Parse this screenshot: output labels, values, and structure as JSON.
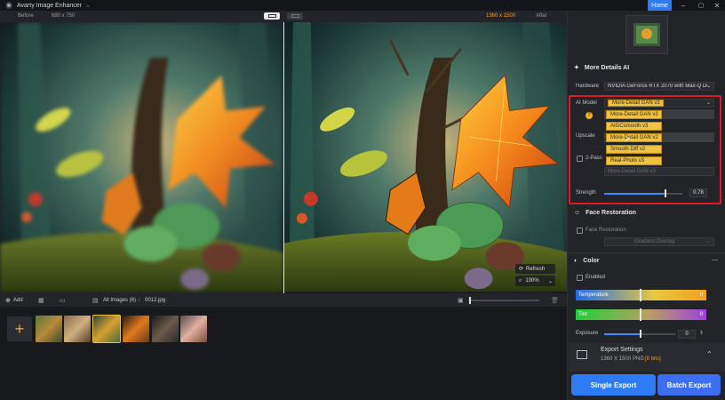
{
  "app": {
    "title": "Avarty Image Enhancer",
    "home": "Home"
  },
  "compare": {
    "before": "Before",
    "before_size": "680 x 750",
    "after_size": "1360 x 1500",
    "after": "After"
  },
  "viewer": {
    "refresh": "Refresh",
    "zoom": "100%"
  },
  "image_bar": {
    "add": "Add",
    "breadcrumb": "All Images (6)",
    "separator": "/",
    "file": "0012.jpg"
  },
  "panel": {
    "section_title": "More Details AI",
    "hardware_label": "Hardware",
    "hardware_value": "NVIDIA GeForce RTX 2070 with Max-Q Desig",
    "ai_model_label": "AI Model",
    "ai_model_value": "More-Detail GAN  v3",
    "upscale_label": "Upscale",
    "two_pass_label": "2-Pass",
    "ghost_select": "More-Detail GAN  v3",
    "options": [
      "More-Detail GAN  v3",
      "AIGCsmooth  v3",
      "More-Detail GAN  v2",
      "Smooth Diff  v2",
      "Real-Photo  v3"
    ],
    "strength_label": "Strength",
    "strength_value": "0.78",
    "strength": 0.78,
    "face_title": "Face Restoration",
    "face_checkbox": "Face Restoration",
    "face_select": "Gradient Overlay",
    "color_title": "Color",
    "enabled_label": "Enabled",
    "temperature_label": "Temperature",
    "temperature_value": "0",
    "tint_label": "Tint",
    "tint_value": "0",
    "exposure_label": "Exposure",
    "exposure_value": "0",
    "export_title": "Export Settings",
    "export_size": "1360 X 1500",
    "export_format": "PNG",
    "export_bits": "[8 bits]",
    "single_export": "Single Export",
    "batch_export": "Batch Export"
  },
  "colors": {
    "accent": "#2f7bf5",
    "gold": "#f0c243",
    "highlight": "#d91a2a"
  }
}
